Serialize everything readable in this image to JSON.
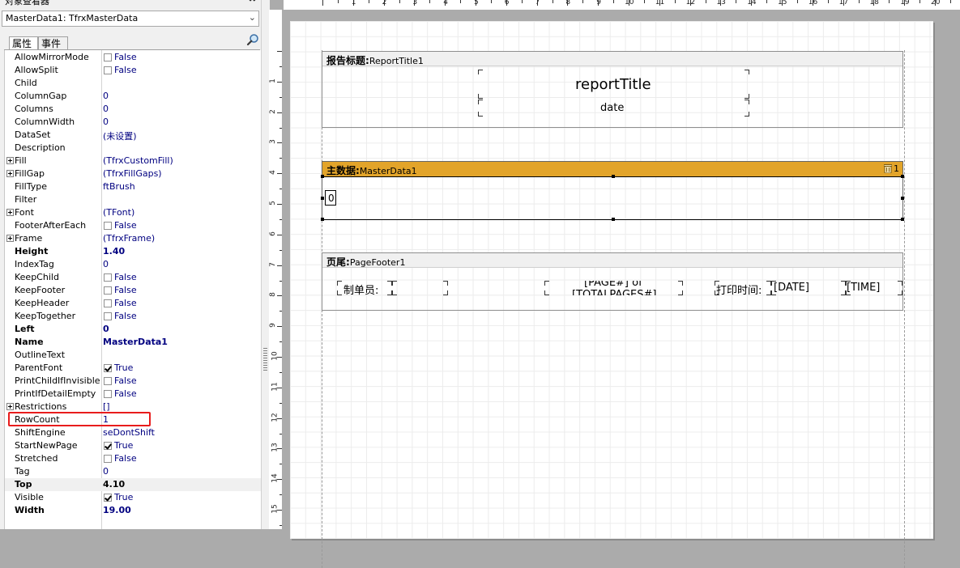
{
  "inspector": {
    "title": "对象查看器",
    "close_icon": "close-icon",
    "object_select": "MasterData1: TfrxMasterData",
    "tabs": [
      "属性",
      "事件"
    ],
    "properties": [
      {
        "name": "AllowMirrorMode",
        "value": "False",
        "checkbox": false
      },
      {
        "name": "AllowSplit",
        "value": "False",
        "checkbox": false
      },
      {
        "name": "Child",
        "value": ""
      },
      {
        "name": "ColumnGap",
        "value": "0"
      },
      {
        "name": "Columns",
        "value": "0"
      },
      {
        "name": "ColumnWidth",
        "value": "0"
      },
      {
        "name": "DataSet",
        "value": "(未设置)"
      },
      {
        "name": "Description",
        "value": ""
      },
      {
        "name": "Fill",
        "value": "(TfrxCustomFill)",
        "expandable": true
      },
      {
        "name": "FillGap",
        "value": "(TfrxFillGaps)",
        "expandable": true
      },
      {
        "name": "FillType",
        "value": "ftBrush"
      },
      {
        "name": "Filter",
        "value": ""
      },
      {
        "name": "Font",
        "value": "(TFont)",
        "expandable": true
      },
      {
        "name": "FooterAfterEach",
        "value": "False",
        "checkbox": false
      },
      {
        "name": "Frame",
        "value": "(TfrxFrame)",
        "expandable": true
      },
      {
        "name": "Height",
        "value": "1.40",
        "bold": true
      },
      {
        "name": "IndexTag",
        "value": "0"
      },
      {
        "name": "KeepChild",
        "value": "False",
        "checkbox": false
      },
      {
        "name": "KeepFooter",
        "value": "False",
        "checkbox": false
      },
      {
        "name": "KeepHeader",
        "value": "False",
        "checkbox": false
      },
      {
        "name": "KeepTogether",
        "value": "False",
        "checkbox": false
      },
      {
        "name": "Left",
        "value": "0",
        "bold": true
      },
      {
        "name": "Name",
        "value": "MasterData1",
        "bold": true
      },
      {
        "name": "OutlineText",
        "value": ""
      },
      {
        "name": "ParentFont",
        "value": "True",
        "checkbox": true
      },
      {
        "name": "PrintChildIfInvisible",
        "value": "False",
        "checkbox": false
      },
      {
        "name": "PrintIfDetailEmpty",
        "value": "False",
        "checkbox": false
      },
      {
        "name": "Restrictions",
        "value": "[]",
        "expandable": true
      },
      {
        "name": "RowCount",
        "value": "1",
        "highlighted": true
      },
      {
        "name": "ShiftEngine",
        "value": "seDontShift"
      },
      {
        "name": "StartNewPage",
        "value": "True",
        "checkbox": true
      },
      {
        "name": "Stretched",
        "value": "False",
        "checkbox": false
      },
      {
        "name": "Tag",
        "value": "0"
      },
      {
        "name": "Top",
        "value": "4.10",
        "bold": true,
        "selected": true
      },
      {
        "name": "Visible",
        "value": "True",
        "checkbox": true
      },
      {
        "name": "Width",
        "value": "19.00",
        "bold": true
      }
    ]
  },
  "ruler": {
    "h_labels": [
      "1",
      "2",
      "3",
      "4",
      "5",
      "6",
      "7",
      "8",
      "9",
      "10",
      "11",
      "12",
      "13",
      "14",
      "15",
      "16",
      "17",
      "18",
      "19",
      "20"
    ],
    "v_labels": [
      "1",
      "2",
      "3",
      "4",
      "5",
      "6",
      "7",
      "8",
      "9",
      "10",
      "11",
      "12",
      "13",
      "14",
      "15"
    ]
  },
  "report": {
    "title_band": {
      "label": "报告标题:",
      "name": "ReportTitle1",
      "report_title": "reportTitle",
      "date": "date"
    },
    "master_band": {
      "label": "主数据:",
      "name": "MasterData1",
      "count": "1",
      "row_value": "0",
      "bin_icon": "data-bin-icon",
      "accent": "#e2a42a"
    },
    "footer_band": {
      "label": "页尾:",
      "name": "PageFooter1",
      "maker": "制单员:",
      "page_line1": "[PAGE#] of",
      "page_line2": "[TOTALPAGES#]",
      "print_time": "打印时间:",
      "date": "[DATE]",
      "time": "[TIME]"
    }
  }
}
